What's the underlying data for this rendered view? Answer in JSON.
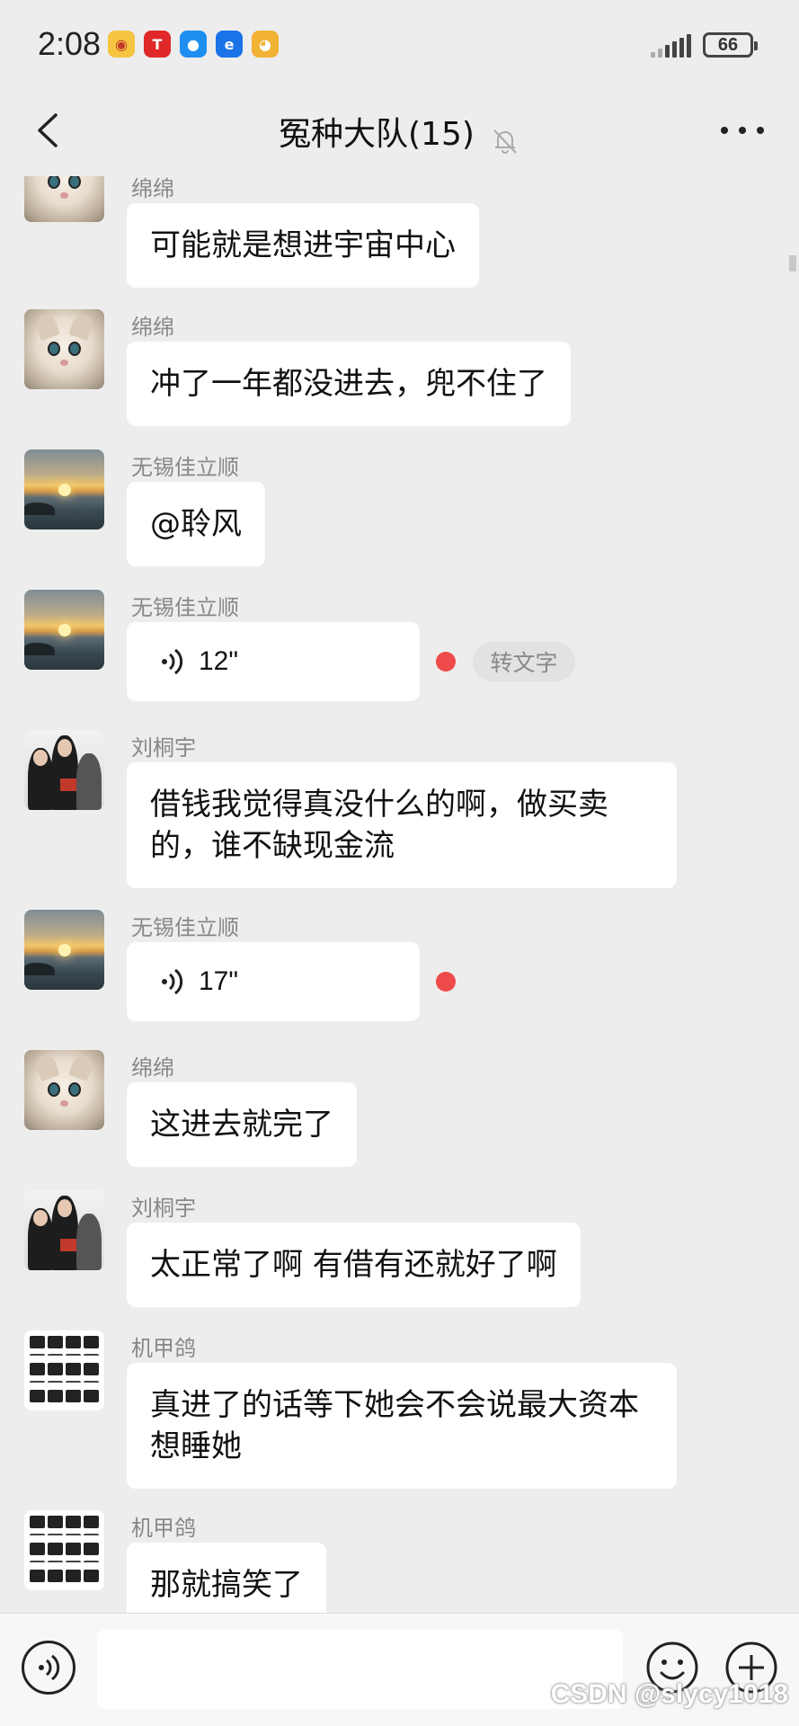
{
  "status_bar": {
    "time": "2:08",
    "battery": "66",
    "notification_icons": [
      {
        "name": "weibo-icon",
        "color": "#f5c542",
        "glyph": "◉"
      },
      {
        "name": "tesla-icon",
        "color": "#e02828",
        "glyph": "T"
      },
      {
        "name": "message-icon",
        "color": "#1f8ef1",
        "glyph": "●"
      },
      {
        "name": "browser-icon",
        "color": "#1a73e8",
        "glyph": "e"
      },
      {
        "name": "game-icon",
        "color": "#f2b233",
        "glyph": "◕"
      }
    ]
  },
  "header": {
    "title": "冤种大队(15)"
  },
  "messages": [
    {
      "sender": "绵绵",
      "avatar": "cat",
      "type": "text",
      "text": "可能就是想进宇宙中心"
    },
    {
      "sender": "绵绵",
      "avatar": "cat",
      "type": "text",
      "text": "冲了一年都没进去，兜不住了"
    },
    {
      "sender": "无锡佳立顺",
      "avatar": "sea",
      "type": "text",
      "text": "@聆风"
    },
    {
      "sender": "无锡佳立顺",
      "avatar": "sea",
      "type": "voice",
      "duration": "12\"",
      "convert_label": "转文字"
    },
    {
      "sender": "刘桐宇",
      "avatar": "people",
      "type": "text",
      "text": "借钱我觉得真没什么的啊，做买卖的，谁不缺现金流"
    },
    {
      "sender": "无锡佳立顺",
      "avatar": "sea",
      "type": "voice",
      "duration": "17\""
    },
    {
      "sender": "绵绵",
      "avatar": "cat",
      "type": "text",
      "text": "这进去就完了"
    },
    {
      "sender": "刘桐宇",
      "avatar": "people",
      "type": "text",
      "text": "太正常了啊 有借有还就好了啊"
    },
    {
      "sender": "机甲鸽",
      "avatar": "icons",
      "type": "text",
      "text": "真进了的话等下她会不会说最大资本想睡她"
    },
    {
      "sender": "机甲鸽",
      "avatar": "icons",
      "type": "text",
      "text": "那就搞笑了"
    }
  ],
  "input": {
    "value": "",
    "placeholder": ""
  },
  "watermark": "CSDN @slycy1018",
  "colors": {
    "background": "#ededed",
    "bubble": "#ffffff",
    "unread_dot": "#ee4a4a",
    "sender_text": "#888888"
  }
}
